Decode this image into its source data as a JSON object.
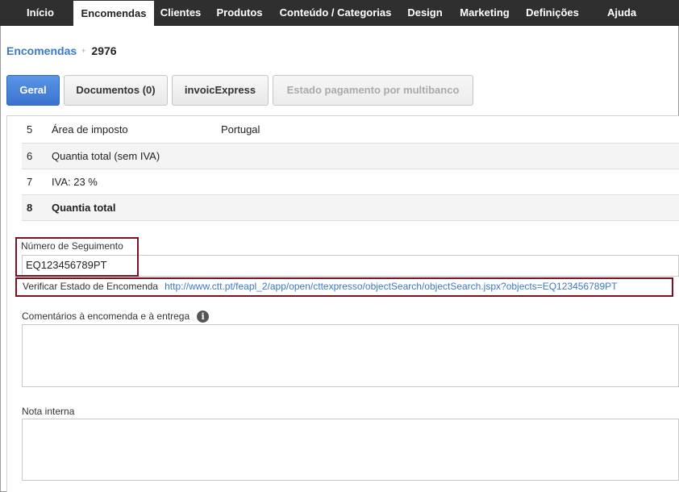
{
  "nav": {
    "items": [
      {
        "label": "Início"
      },
      {
        "label": "Encomendas"
      },
      {
        "label": "Clientes"
      },
      {
        "label": "Produtos"
      },
      {
        "label": "Conteúdo / Categorias"
      },
      {
        "label": "Design"
      },
      {
        "label": "Marketing"
      },
      {
        "label": "Definições"
      },
      {
        "label": "Ajuda"
      }
    ],
    "active": "Encomendas"
  },
  "breadcrumb": {
    "parent": "Encomendas",
    "separator": "+",
    "current": "2976"
  },
  "tabs": [
    {
      "label": "Geral",
      "state": "active"
    },
    {
      "label": "Documentos (0)",
      "state": "normal"
    },
    {
      "label": "invoicExpress",
      "state": "normal"
    },
    {
      "label": "Estado pagamento por multibanco",
      "state": "disabled"
    }
  ],
  "summary_rows": [
    {
      "num": "5",
      "label": "Área de imposto",
      "value": "Portugal",
      "bold": false
    },
    {
      "num": "6",
      "label": "Quantia total (sem IVA)",
      "value": "",
      "bold": false
    },
    {
      "num": "7",
      "label": "IVA: 23 %",
      "value": "",
      "bold": false
    },
    {
      "num": "8",
      "label": "Quantia total",
      "value": "",
      "bold": true
    }
  ],
  "tracking": {
    "label": "Número de Seguimento",
    "value": "EQ123456789PT"
  },
  "verify": {
    "label": "Verificar Estado de Encomenda",
    "link": "http://www.ctt.pt/feapl_2/app/open/cttexpresso/objectSearch/objectSearch.jspx?objects=EQ123456789PT"
  },
  "comments": {
    "label": "Comentários à encomenda e à entrega",
    "info_icon": "info-icon",
    "value": ""
  },
  "internal_note": {
    "label": "Nota interna",
    "value": ""
  },
  "colors": {
    "nav_bg": "#2f2f2f",
    "accent": "#3b78c8",
    "highlight_box": "#7a1020"
  }
}
